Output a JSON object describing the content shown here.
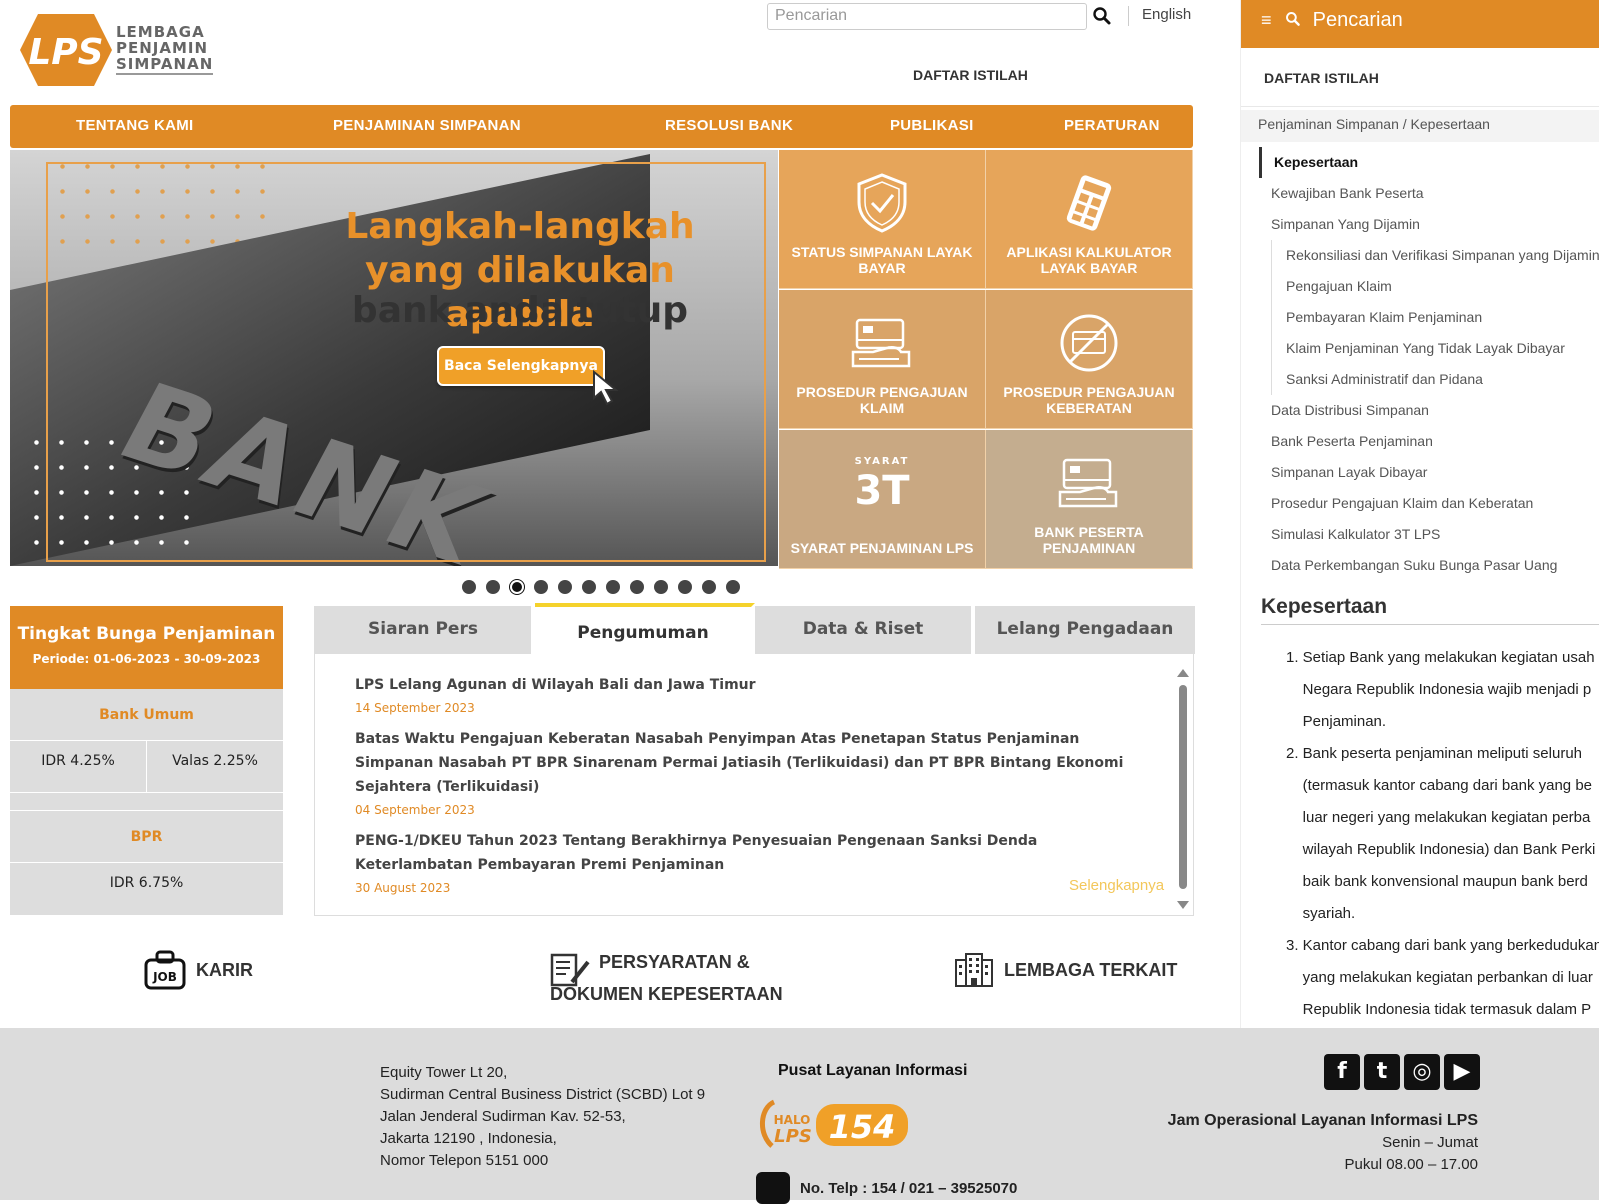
{
  "header": {
    "logo_text": "LPS",
    "logo_words": [
      "LEMBAGA",
      "PENJAMIN",
      "SIMPANAN"
    ],
    "search_placeholder": "Pencarian",
    "language": "English",
    "glossary": "DAFTAR ISTILAH"
  },
  "nav": [
    "TENTANG KAMI",
    "PENJAMINAN SIMPANAN",
    "RESOLUSI BANK",
    "PUBLIKASI",
    "PERATURAN"
  ],
  "hero": {
    "title_line1": "Langkah-langkah",
    "title_line2": "yang dilakukan apabila",
    "title_line3": "bank anda tutup",
    "button": "Baca Selengkapnya",
    "building_text": "BANK",
    "slides_count": 12,
    "active_slide": 3
  },
  "tiles": [
    {
      "label": "STATUS SIMPANAN LAYAK BAYAR",
      "icon": "shield-check-icon"
    },
    {
      "label": "APLIKASI KALKULATOR LAYAK BAYAR",
      "icon": "calculator-icon"
    },
    {
      "label": "PROSEDUR PENGAJUAN KLAIM",
      "icon": "card-hand-icon"
    },
    {
      "label": "PROSEDUR PENGAJUAN KEBERATAN",
      "icon": "no-card-icon"
    },
    {
      "label": "SYARAT PENJAMINAN LPS",
      "icon": "syarat-3t-icon",
      "icon_text_small": "SYARAT",
      "icon_text_big": "3T"
    },
    {
      "label": "BANK PESERTA PENJAMINAN",
      "icon": "card-hand-icon"
    }
  ],
  "rates": {
    "title": "Tingkat Bunga Penjaminan",
    "period": "Periode: 01-06-2023 - 30-09-2023",
    "bank_umum_label": "Bank Umum",
    "bank_umum_idr": "IDR 4.25%",
    "bank_umum_valas": "Valas 2.25%",
    "bpr_label": "BPR",
    "bpr_idr": "IDR 6.75%"
  },
  "tabs": [
    "Siaran Pers",
    "Pengumuman",
    "Data & Riset",
    "Lelang Pengadaan"
  ],
  "active_tab": "Pengumuman",
  "news": [
    {
      "title": "LPS Lelang Agunan di Wilayah Bali dan Jawa Timur",
      "date": "14 September 2023"
    },
    {
      "title": "Batas Waktu Pengajuan Keberatan Nasabah Penyimpan Atas Penetapan Status Penjaminan Simpanan Nasabah PT BPR Sinarenam Permai Jatiasih (Terlikuidasi) dan PT BPR Bintang Ekonomi Sejahtera (Terlikuidasi)",
      "date": "04 September 2023"
    },
    {
      "title": "PENG-1/DKEU Tahun 2023 Tentang Berakhirnya Penyesuaian Pengenaan Sanksi Denda Keterlambatan Pembayaran Premi Penjaminan",
      "date": "30 August 2023"
    }
  ],
  "more_link": "Selengkapnya",
  "bottom_links": {
    "karir": "KARIR",
    "karir_icon_text": "JOB",
    "persyaratan_line1": "PERSYARATAN &",
    "persyaratan_line2": "DOKUMEN KEPESERTAAN",
    "lembaga": "LEMBAGA TERKAIT"
  },
  "footer": {
    "address": [
      "Equity Tower Lt 20,",
      "Sudirman Central Business District (SCBD) Lot 9",
      "Jalan Jenderal Sudirman Kav. 52-53,",
      "Jakarta 12190 , Indonesia,",
      "Nomor Telepon 5151 000"
    ],
    "pusat_layanan": "Pusat Layanan Informasi",
    "halo_small": "HALO",
    "halo_lps": "LPS",
    "halo_number": "154",
    "phone": "No. Telp : 154 / 021 – 39525070",
    "jam_title": "Jam Operasional Layanan Informasi LPS",
    "jam_days": "Senin – Jumat",
    "jam_hours": "Pukul 08.00 – 17.00",
    "social": [
      {
        "icon": "facebook-icon",
        "glyph": "f"
      },
      {
        "icon": "twitter-icon",
        "glyph": "t"
      },
      {
        "icon": "instagram-icon",
        "glyph": "◎"
      },
      {
        "icon": "youtube-icon",
        "glyph": "▶"
      }
    ]
  },
  "sidebar": {
    "search_label": "Pencarian",
    "glossary": "DAFTAR ISTILAH",
    "breadcrumb": "Penjaminan Simpanan  /  Kepesertaan",
    "menu": [
      {
        "label": "Kepesertaan",
        "type": "act"
      },
      {
        "label": "Kewajiban Bank Peserta",
        "type": "top"
      },
      {
        "label": "Simpanan Yang Dijamin",
        "type": "top"
      },
      {
        "label": "Rekonsiliasi dan Verifikasi Simpanan yang Dijamin",
        "type": "sub"
      },
      {
        "label": "Pengajuan Klaim",
        "type": "sub"
      },
      {
        "label": "Pembayaran Klaim Penjaminan",
        "type": "sub"
      },
      {
        "label": "Klaim Penjaminan Yang Tidak Layak Dibayar",
        "type": "sub"
      },
      {
        "label": "Sanksi Administratif dan Pidana",
        "type": "sub"
      },
      {
        "label": "Data Distribusi Simpanan",
        "type": "top"
      },
      {
        "label": "Bank Peserta Penjaminan",
        "type": "top"
      },
      {
        "label": "Simpanan Layak Dibayar",
        "type": "top"
      },
      {
        "label": "Prosedur Pengajuan Klaim dan Keberatan",
        "type": "top"
      },
      {
        "label": "Simulasi Kalkulator 3T LPS",
        "type": "top"
      },
      {
        "label": "Data Perkembangan Suku Bunga Pasar Uang",
        "type": "top"
      }
    ],
    "heading": "Kepesertaan",
    "content_lines": [
      "1. Setiap Bank yang melakukan kegiatan usah",
      "    Negara Republik Indonesia wajib menjadi p",
      "    Penjaminan.",
      "2. Bank peserta penjaminan meliputi seluruh",
      "    (termasuk kantor cabang dari bank yang be",
      "    luar negeri yang melakukan kegiatan perba",
      "    wilayah Republik Indonesia) dan Bank Perki",
      "    baik bank konvensional maupun bank berd",
      "    syariah.",
      "3. Kantor cabang dari bank yang berkedudukan",
      "    yang melakukan kegiatan perbankan di luar",
      "    Republik Indonesia tidak termasuk dalam P"
    ]
  },
  "colors": {
    "brand_orange": "#e08a25",
    "tab_active_border": "#f5d22b",
    "link_yellow": "#f3c75a"
  }
}
